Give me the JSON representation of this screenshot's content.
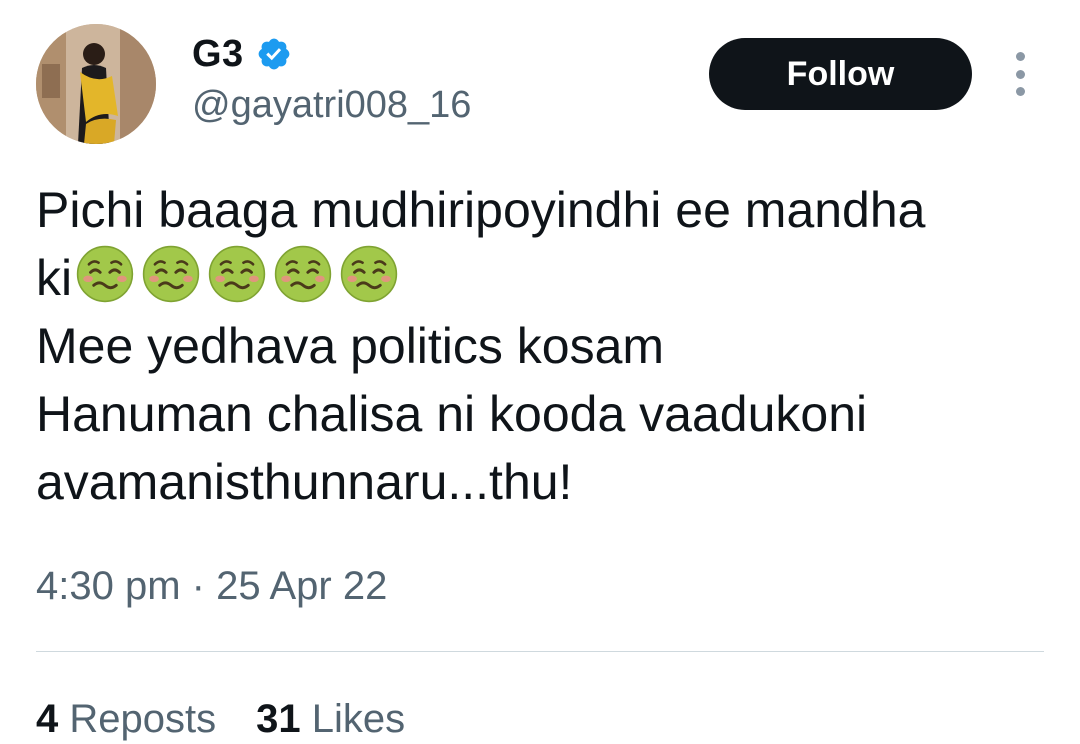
{
  "author": {
    "display_name": "G3",
    "handle": "@gayatri008_16",
    "verified": true,
    "verified_icon": "verified-badge-icon",
    "verified_color": "#1d9bf0"
  },
  "follow_label": "Follow",
  "more_icon": "more-vertical-icon",
  "tweet": {
    "line1": "Pichi baaga mudhiripoyindhi ee mandha",
    "line2_text": "ki",
    "emoji": "nauseated-face-emoji",
    "emoji_count": 5,
    "line3": "Mee yedhava politics kosam",
    "line4": "Hanuman chalisa ni kooda vaadukoni",
    "line5": "avamanisthunnaru...thu!"
  },
  "timestamp": "4:30 pm · 25 Apr 22",
  "stats": {
    "reposts_count": "4",
    "reposts_label": "Reposts",
    "likes_count": "31",
    "likes_label": "Likes"
  },
  "colors": {
    "text_primary": "#0f1419",
    "text_secondary": "#536471",
    "button_bg": "#0f1419",
    "divider": "#cfd9de"
  }
}
